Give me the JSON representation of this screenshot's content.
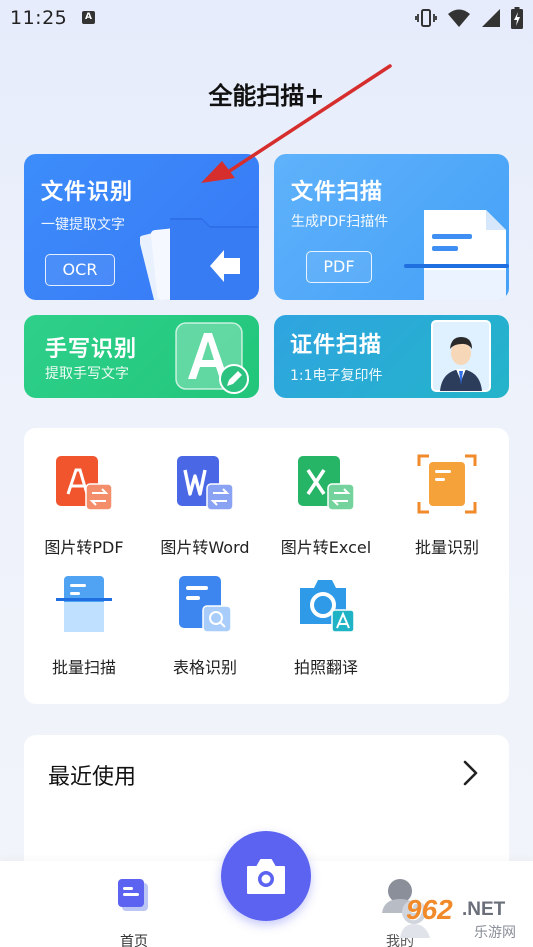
{
  "status_bar": {
    "time": "11:25",
    "notification_letter": "A",
    "icons": [
      "vibrate-icon",
      "wifi-icon",
      "signal-icon",
      "battery-charging-icon"
    ]
  },
  "app": {
    "title": "全能扫描+"
  },
  "cards": {
    "ocr": {
      "title": "文件识别",
      "subtitle": "一键提取文字",
      "tag": "OCR",
      "color": "#3d8dfb"
    },
    "pdf": {
      "title": "文件扫描",
      "subtitle": "生成PDF扫描件",
      "tag": "PDF",
      "color": "#5fb2fb"
    },
    "handwriting": {
      "title": "手写识别",
      "subtitle": "提取手写文字",
      "color": "#2ed08a"
    },
    "id_scan": {
      "title": "证件扫描",
      "subtitle": "1:1电子复印件",
      "color": "#2fa4e0"
    }
  },
  "tools": [
    {
      "label": "图片转PDF",
      "icon": "image-to-pdf-icon"
    },
    {
      "label": "图片转Word",
      "icon": "image-to-word-icon"
    },
    {
      "label": "图片转Excel",
      "icon": "image-to-excel-icon"
    },
    {
      "label": "批量识别",
      "icon": "batch-recognize-icon"
    },
    {
      "label": "批量扫描",
      "icon": "batch-scan-icon"
    },
    {
      "label": "表格识别",
      "icon": "table-recognize-icon"
    },
    {
      "label": "拍照翻译",
      "icon": "photo-translate-icon"
    }
  ],
  "recent": {
    "title": "最近使用"
  },
  "bottom_nav": {
    "home_label": "首页",
    "mine_label": "我的",
    "camera_color": "#5b63f0"
  },
  "watermark": {
    "text_main": "962",
    "text_net": ".NET",
    "text_sub": "乐游网"
  }
}
